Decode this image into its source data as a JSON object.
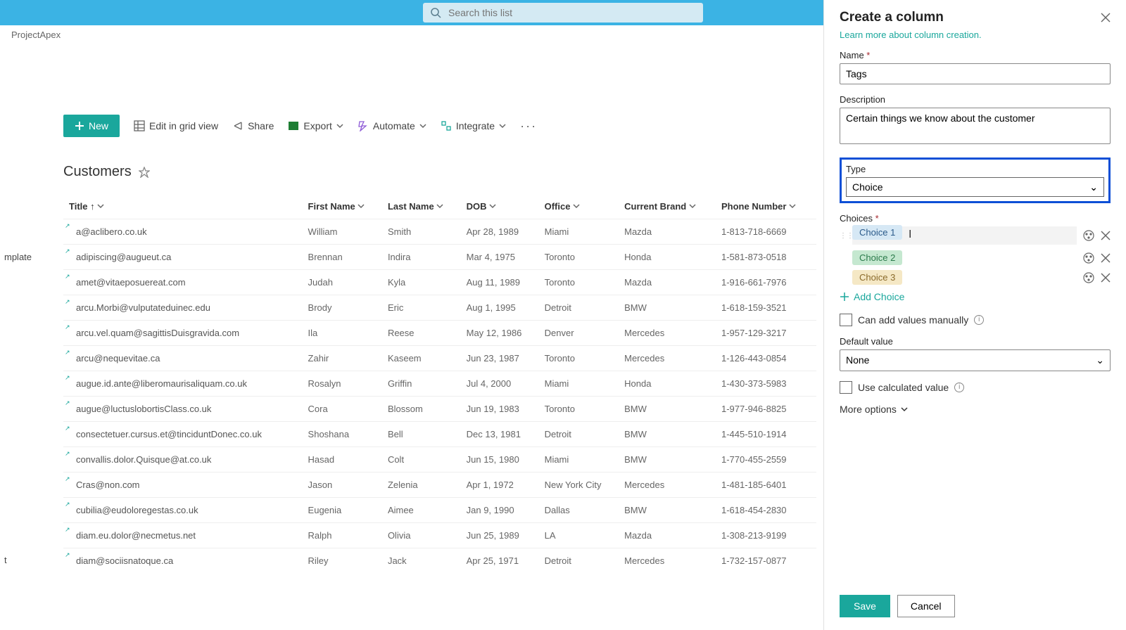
{
  "search": {
    "placeholder": "Search this list"
  },
  "breadcrumb": "ProjectApex",
  "leftnav": {
    "item1": "mplate",
    "item2": "t"
  },
  "toolbar": {
    "new": "New",
    "edit_grid": "Edit in grid view",
    "share": "Share",
    "export": "Export",
    "automate": "Automate",
    "integrate": "Integrate"
  },
  "list": {
    "title": "Customers"
  },
  "columns": {
    "title": "Title",
    "first": "First Name",
    "last": "Last Name",
    "dob": "DOB",
    "office": "Office",
    "brand": "Current Brand",
    "phone": "Phone Number"
  },
  "rows": [
    {
      "t": "a@aclibero.co.uk",
      "f": "William",
      "l": "Smith",
      "d": "Apr 28, 1989",
      "o": "Miami",
      "b": "Mazda",
      "p": "1-813-718-6669"
    },
    {
      "t": "adipiscing@augueut.ca",
      "f": "Brennan",
      "l": "Indira",
      "d": "Mar 4, 1975",
      "o": "Toronto",
      "b": "Honda",
      "p": "1-581-873-0518"
    },
    {
      "t": "amet@vitaeposuereat.com",
      "f": "Judah",
      "l": "Kyla",
      "d": "Aug 11, 1989",
      "o": "Toronto",
      "b": "Mazda",
      "p": "1-916-661-7976"
    },
    {
      "t": "arcu.Morbi@vulputateduinec.edu",
      "f": "Brody",
      "l": "Eric",
      "d": "Aug 1, 1995",
      "o": "Detroit",
      "b": "BMW",
      "p": "1-618-159-3521"
    },
    {
      "t": "arcu.vel.quam@sagittisDuisgravida.com",
      "f": "Ila",
      "l": "Reese",
      "d": "May 12, 1986",
      "o": "Denver",
      "b": "Mercedes",
      "p": "1-957-129-3217"
    },
    {
      "t": "arcu@nequevitae.ca",
      "f": "Zahir",
      "l": "Kaseem",
      "d": "Jun 23, 1987",
      "o": "Toronto",
      "b": "Mercedes",
      "p": "1-126-443-0854"
    },
    {
      "t": "augue.id.ante@liberomaurisaliquam.co.uk",
      "f": "Rosalyn",
      "l": "Griffin",
      "d": "Jul 4, 2000",
      "o": "Miami",
      "b": "Honda",
      "p": "1-430-373-5983"
    },
    {
      "t": "augue@luctuslobortisClass.co.uk",
      "f": "Cora",
      "l": "Blossom",
      "d": "Jun 19, 1983",
      "o": "Toronto",
      "b": "BMW",
      "p": "1-977-946-8825"
    },
    {
      "t": "consectetuer.cursus.et@tinciduntDonec.co.uk",
      "f": "Shoshana",
      "l": "Bell",
      "d": "Dec 13, 1981",
      "o": "Detroit",
      "b": "BMW",
      "p": "1-445-510-1914"
    },
    {
      "t": "convallis.dolor.Quisque@at.co.uk",
      "f": "Hasad",
      "l": "Colt",
      "d": "Jun 15, 1980",
      "o": "Miami",
      "b": "BMW",
      "p": "1-770-455-2559"
    },
    {
      "t": "Cras@non.com",
      "f": "Jason",
      "l": "Zelenia",
      "d": "Apr 1, 1972",
      "o": "New York City",
      "b": "Mercedes",
      "p": "1-481-185-6401"
    },
    {
      "t": "cubilia@eudoloregestas.co.uk",
      "f": "Eugenia",
      "l": "Aimee",
      "d": "Jan 9, 1990",
      "o": "Dallas",
      "b": "BMW",
      "p": "1-618-454-2830"
    },
    {
      "t": "diam.eu.dolor@necmetus.net",
      "f": "Ralph",
      "l": "Olivia",
      "d": "Jun 25, 1989",
      "o": "LA",
      "b": "Mazda",
      "p": "1-308-213-9199"
    },
    {
      "t": "diam@sociisnatoque.ca",
      "f": "Riley",
      "l": "Jack",
      "d": "Apr 25, 1971",
      "o": "Detroit",
      "b": "Mercedes",
      "p": "1-732-157-0877"
    }
  ],
  "panel": {
    "title": "Create a column",
    "learn": "Learn more about column creation.",
    "name_label": "Name",
    "name_value": "Tags",
    "desc_label": "Description",
    "desc_value": "Certain things we know about the customer",
    "type_label": "Type",
    "type_value": "Choice",
    "choices_label": "Choices",
    "choices": [
      "Choice 1",
      "Choice 2",
      "Choice 3"
    ],
    "add_choice": "Add Choice",
    "can_add": "Can add values manually",
    "default_label": "Default value",
    "default_value": "None",
    "use_calc": "Use calculated value",
    "more": "More options",
    "save": "Save",
    "cancel": "Cancel"
  }
}
